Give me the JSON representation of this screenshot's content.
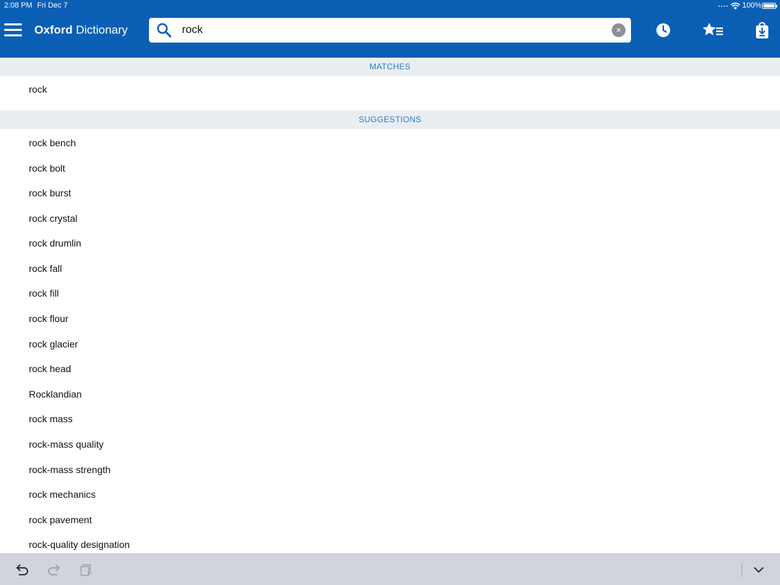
{
  "status": {
    "time": "2:08 PM",
    "date": "Fri Dec 7",
    "battery": "100%"
  },
  "appbar": {
    "title_bold": "Oxford",
    "title_rest": " Dictionary",
    "icons": [
      "menu-icon",
      "search-icon",
      "clear-icon",
      "history-icon",
      "favorites-icon",
      "downloads-icon"
    ]
  },
  "search": {
    "value": "rock",
    "placeholder": ""
  },
  "matches": {
    "header": "MATCHES",
    "items": [
      "rock"
    ]
  },
  "suggestions": {
    "header": "SUGGESTIONS",
    "items": [
      "rock bench",
      "rock bolt",
      "rock burst",
      "rock crystal",
      "rock drumlin",
      "rock fall",
      "rock fill",
      "rock flour",
      "rock glacier",
      "rock head",
      "Rocklandian",
      "rock mass",
      "rock-mass quality",
      "rock-mass strength",
      "rock mechanics",
      "rock pavement",
      "rock-quality designation"
    ]
  },
  "keyboard_bar": {
    "icons": [
      "undo-icon",
      "redo-icon",
      "paste-icon",
      "chevron-down-icon"
    ]
  },
  "colors": {
    "brand": "#0a5fb4",
    "section_header_bg": "#eaeef3",
    "section_header_text": "#2b7bbf"
  }
}
